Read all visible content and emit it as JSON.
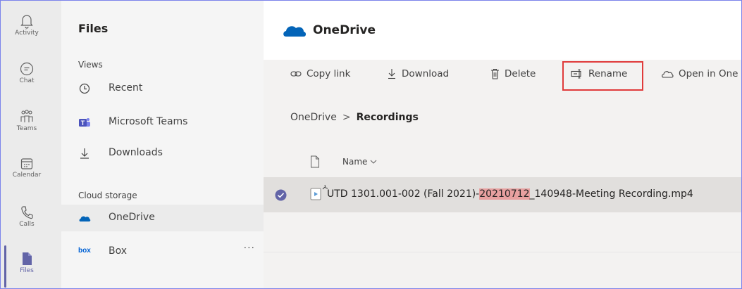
{
  "rail": {
    "items": [
      {
        "label": "Activity",
        "icon": "bell-icon"
      },
      {
        "label": "Chat",
        "icon": "chat-icon"
      },
      {
        "label": "Teams",
        "icon": "teams-icon"
      },
      {
        "label": "Calendar",
        "icon": "calendar-icon"
      },
      {
        "label": "Calls",
        "icon": "phone-icon"
      },
      {
        "label": "Files",
        "icon": "file-icon",
        "active": true
      }
    ]
  },
  "nav": {
    "title": "Files",
    "views_label": "Views",
    "views": [
      {
        "label": "Recent",
        "icon": "clock-icon"
      },
      {
        "label": "Microsoft Teams",
        "icon": "teams-logo-icon"
      },
      {
        "label": "Downloads",
        "icon": "download-icon"
      }
    ],
    "cloud_label": "Cloud storage",
    "cloud": [
      {
        "label": "OneDrive",
        "icon": "onedrive-icon",
        "selected": true
      },
      {
        "label": "Box",
        "icon": "box-logo-icon",
        "more": "···"
      }
    ]
  },
  "header": {
    "title": "OneDrive"
  },
  "toolbar": {
    "copy_link": "Copy link",
    "download": "Download",
    "delete": "Delete",
    "rename": "Rename",
    "open_in": "Open in One"
  },
  "breadcrumb": {
    "root": "OneDrive",
    "separator": ">",
    "current": "Recordings"
  },
  "list": {
    "column_name": "Name",
    "file": {
      "name_part1": "UTD 1301.001-002 (Fall 2021)-",
      "name_highlight": "20210712",
      "name_part2": "_140948-Meeting Recording.mp4"
    }
  },
  "colors": {
    "accent": "#6264a7",
    "highlight_box": "#e03b3b",
    "onedrive_blue": "#0364b8"
  }
}
